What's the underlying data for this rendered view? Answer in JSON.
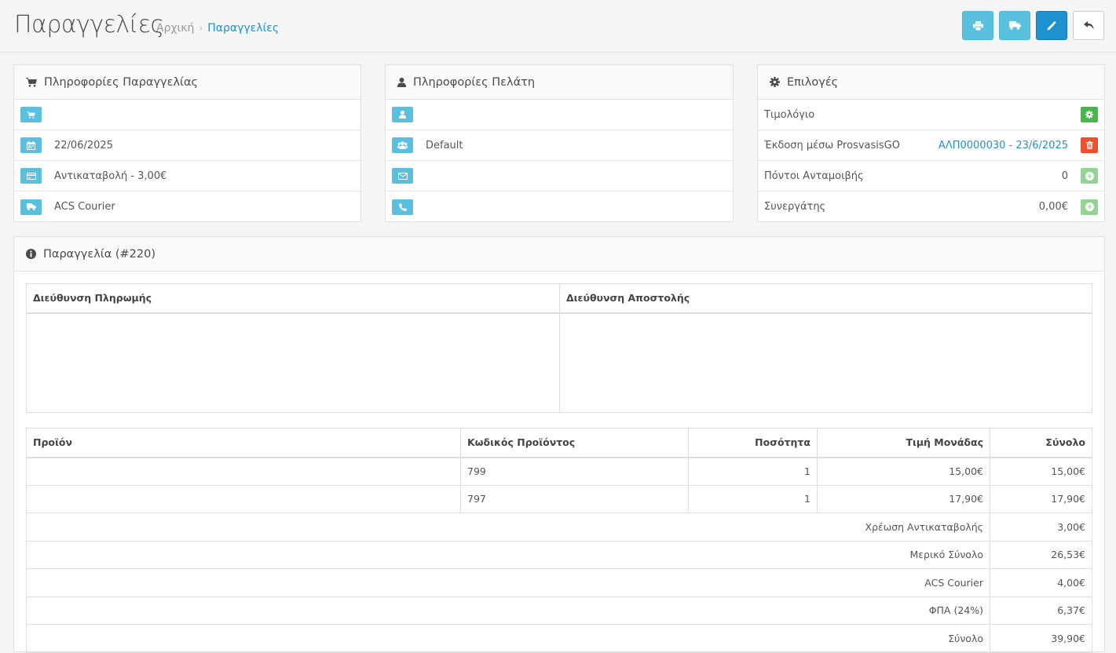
{
  "header": {
    "title": "Παραγγελίες",
    "breadcrumb": [
      "Αρχική",
      "Παραγγελίες"
    ],
    "actions": [
      "print-icon",
      "truck-icon",
      "pencil-icon",
      "reply-icon"
    ]
  },
  "order_info": {
    "title": "Πληροφορίες Παραγγελίας",
    "date": "22/06/2025",
    "payment": "Αντικαταβολή - 3,00€",
    "shipping": "ACS Courier"
  },
  "customer_info": {
    "title": "Πληροφορίες Πελάτη",
    "group": "Default"
  },
  "options": {
    "title": "Επιλογές",
    "invoice_label": "Τιμολόγιο",
    "issue_label": "Έκδοση μέσω ProsvasisGO",
    "issue_value": "ΑΛΠ0000030 - 23/6/2025",
    "points_label": "Πόντοι Ανταμοιβής",
    "points_value": "0",
    "affiliate_label": "Συνεργάτης",
    "affiliate_value": "0,00€"
  },
  "order": {
    "title": "Παραγγελία (#220)",
    "address_headers": [
      "Διεύθυνση Πληρωμής",
      "Διεύθυνση Αποστολής"
    ],
    "product_headers": [
      "Προϊόν",
      "Κωδικός Προϊόντος",
      "Ποσότητα",
      "Τιμή Μονάδας",
      "Σύνολο"
    ],
    "products": [
      {
        "name": "",
        "model": "799",
        "qty": "1",
        "price": "15,00€",
        "total": "15,00€"
      },
      {
        "name": "",
        "model": "797",
        "qty": "1",
        "price": "17,90€",
        "total": "17,90€"
      }
    ],
    "totals": [
      {
        "label": "Χρέωση Αντικαταβολής",
        "value": "3,00€"
      },
      {
        "label": "Μερικό Σύνολο",
        "value": "26,53€"
      },
      {
        "label": "ACS Courier",
        "value": "4,00€"
      },
      {
        "label": "ΦΠΑ (24%)",
        "value": "6,37€"
      },
      {
        "label": "Σύνολο",
        "value": "39,90€"
      }
    ]
  },
  "colors": {
    "accent": "#1e91cf",
    "info": "#5bc0de",
    "success": "#4cb64c",
    "danger": "#f04e2f"
  }
}
